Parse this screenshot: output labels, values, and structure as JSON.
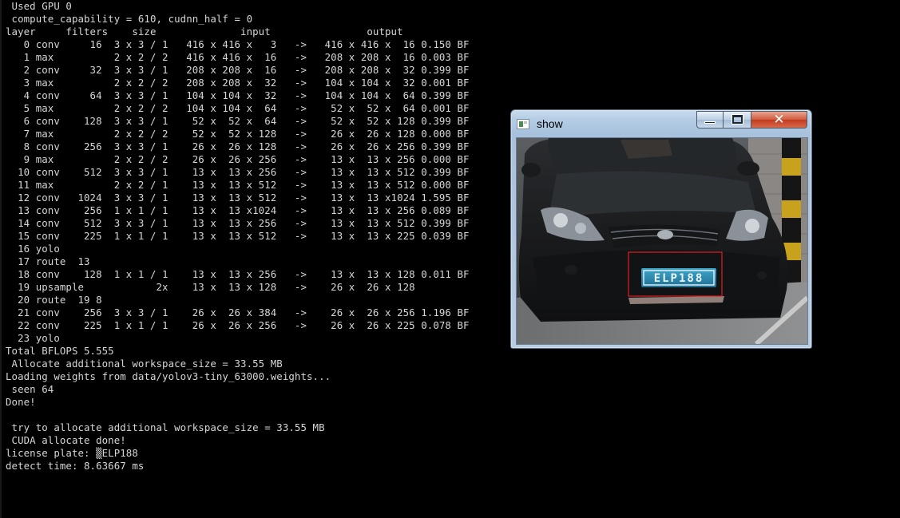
{
  "console": {
    "lines": [
      " Used GPU 0",
      " compute_capability = 610, cudnn_half = 0",
      "layer     filters    size              input                output",
      "   0 conv     16  3 x 3 / 1   416 x 416 x   3   ->   416 x 416 x  16 0.150 BF",
      "   1 max          2 x 2 / 2   416 x 416 x  16   ->   208 x 208 x  16 0.003 BF",
      "   2 conv     32  3 x 3 / 1   208 x 208 x  16   ->   208 x 208 x  32 0.399 BF",
      "   3 max          2 x 2 / 2   208 x 208 x  32   ->   104 x 104 x  32 0.001 BF",
      "   4 conv     64  3 x 3 / 1   104 x 104 x  32   ->   104 x 104 x  64 0.399 BF",
      "   5 max          2 x 2 / 2   104 x 104 x  64   ->    52 x  52 x  64 0.001 BF",
      "   6 conv    128  3 x 3 / 1    52 x  52 x  64   ->    52 x  52 x 128 0.399 BF",
      "   7 max          2 x 2 / 2    52 x  52 x 128   ->    26 x  26 x 128 0.000 BF",
      "   8 conv    256  3 x 3 / 1    26 x  26 x 128   ->    26 x  26 x 256 0.399 BF",
      "   9 max          2 x 2 / 2    26 x  26 x 256   ->    13 x  13 x 256 0.000 BF",
      "  10 conv    512  3 x 3 / 1    13 x  13 x 256   ->    13 x  13 x 512 0.399 BF",
      "  11 max          2 x 2 / 1    13 x  13 x 512   ->    13 x  13 x 512 0.000 BF",
      "  12 conv   1024  3 x 3 / 1    13 x  13 x 512   ->    13 x  13 x1024 1.595 BF",
      "  13 conv    256  1 x 1 / 1    13 x  13 x1024   ->    13 x  13 x 256 0.089 BF",
      "  14 conv    512  3 x 3 / 1    13 x  13 x 256   ->    13 x  13 x 512 0.399 BF",
      "  15 conv    225  1 x 1 / 1    13 x  13 x 512   ->    13 x  13 x 225 0.039 BF",
      "  16 yolo",
      "  17 route  13",
      "  18 conv    128  1 x 1 / 1    13 x  13 x 256   ->    13 x  13 x 128 0.011 BF",
      "  19 upsample            2x    13 x  13 x 128   ->    26 x  26 x 128",
      "  20 route  19 8",
      "  21 conv    256  3 x 3 / 1    26 x  26 x 384   ->    26 x  26 x 256 1.196 BF",
      "  22 conv    225  1 x 1 / 1    26 x  26 x 256   ->    26 x  26 x 225 0.078 BF",
      "  23 yolo",
      "Total BFLOPS 5.555",
      " Allocate additional workspace_size = 33.55 MB",
      "Loading weights from data/yolov3-tiny_63000.weights...",
      " seen 64",
      "Done!",
      "",
      " try to allocate additional workspace_size = 33.55 MB",
      " CUDA allocate done!",
      "license plate: ▒ELP188",
      "detect time: 8.63667 ms"
    ]
  },
  "show_window": {
    "title": "show",
    "close_symbol": "✕",
    "image": {
      "plate_text": "ELP188",
      "detection_box_color": "#e02020"
    }
  },
  "colors": {
    "console_bg": "#000000",
    "console_text": "#d6d6d6"
  }
}
